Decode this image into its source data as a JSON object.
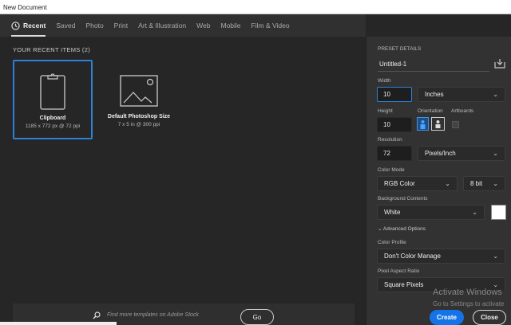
{
  "window": {
    "title": "New Document"
  },
  "tabs": [
    {
      "label": "Recent"
    },
    {
      "label": "Saved"
    },
    {
      "label": "Photo"
    },
    {
      "label": "Print"
    },
    {
      "label": "Art & Illustration"
    },
    {
      "label": "Web"
    },
    {
      "label": "Mobile"
    },
    {
      "label": "Film & Video"
    }
  ],
  "recent": {
    "heading": "YOUR RECENT ITEMS  (2)",
    "items": [
      {
        "name": "Clipboard",
        "size": "1185 x 772 px @ 72 ppi"
      },
      {
        "name": "Default Photoshop Size",
        "size": "7 x 5 in @ 300 ppi"
      }
    ]
  },
  "stock": {
    "placeholder": "Find more templates on Adobe Stock",
    "go": "Go"
  },
  "preset": {
    "heading": "PRESET DETAILS",
    "name": "Untitled-1",
    "width_label": "Width",
    "width": "10",
    "width_unit": "Inches",
    "height_label": "Height",
    "height": "10",
    "orientation_label": "Orientation",
    "artboards_label": "Artboards",
    "resolution_label": "Resolution",
    "resolution": "72",
    "resolution_unit": "Pixels/Inch",
    "color_mode_label": "Color Mode",
    "color_mode": "RGB Color",
    "bit_depth": "8 bit",
    "bg_label": "Background Contents",
    "bg": "White",
    "bg_color": "#ffffff",
    "advanced": "Advanced Options",
    "profile_label": "Color Profile",
    "profile": "Don't Color Manage",
    "par_label": "Pixel Aspect Ratio",
    "par": "Square Pixels"
  },
  "buttons": {
    "create": "Create",
    "close": "Close"
  },
  "watermark": {
    "line1": "Activate Windows",
    "line2": "Go to Settings to activate"
  },
  "colors": {
    "accent": "#2d80d8"
  }
}
